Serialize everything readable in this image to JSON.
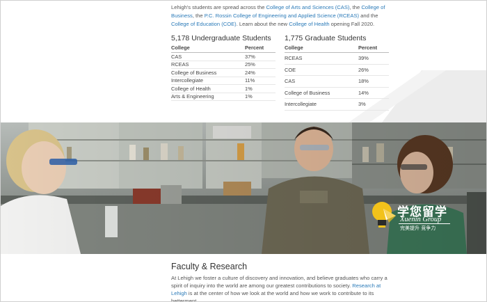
{
  "intro": {
    "t1": "Lehigh's students are spread across the ",
    "l1": "College of Arts and Sciences (CAS)",
    "t2": ", the ",
    "l2": "College of Business",
    "t3": ", the ",
    "l3": "P.C. Rossin College of Engineering and Applied Science (RCEAS)",
    "t4": " and the ",
    "l4": "College of Education (COE)",
    "t5": ". Learn about the new ",
    "l5": "College of Health",
    "t6": " opening Fall 2020."
  },
  "undergrad": {
    "title": "5,178 Undergraduate Students",
    "col_college": "College",
    "col_percent": "Percent",
    "rows": [
      {
        "college": "CAS",
        "percent": "37%"
      },
      {
        "college": "RCEAS",
        "percent": "25%"
      },
      {
        "college": "College of Business",
        "percent": "24%"
      },
      {
        "college": "Intercollegiate",
        "percent": "11%"
      },
      {
        "college": "College of Health",
        "percent": "1%"
      },
      {
        "college": "Arts & Engineering",
        "percent": "1%"
      }
    ]
  },
  "graduate": {
    "title": "1,775 Graduate Students",
    "col_college": "College",
    "col_percent": "Percent",
    "rows": [
      {
        "college": "RCEAS",
        "percent": "39%"
      },
      {
        "college": "COE",
        "percent": "26%"
      },
      {
        "college": "CAS",
        "percent": "18%"
      },
      {
        "college": "College of Business",
        "percent": "14%"
      },
      {
        "college": "Intercollegiate",
        "percent": "3%"
      }
    ]
  },
  "watermark": {
    "cn": "学您留学",
    "en": "Xuenin Group",
    "tagline": "完美提升  竞争力"
  },
  "faculty": {
    "title": "Faculty & Research",
    "t1": "At Lehigh we foster a culture of discovery and innovation, and believe graduates who carry a spirit of inquiry into the world are among our greatest contributions to society. ",
    "l1": "Research at Lehigh",
    "t2": " is at the center of how we look at the world and how we work to contribute to its betterment."
  },
  "colors": {
    "link": "#2a7ab8",
    "text": "#555555",
    "heading": "#333333",
    "logo_yellow": "#f2c21b"
  }
}
